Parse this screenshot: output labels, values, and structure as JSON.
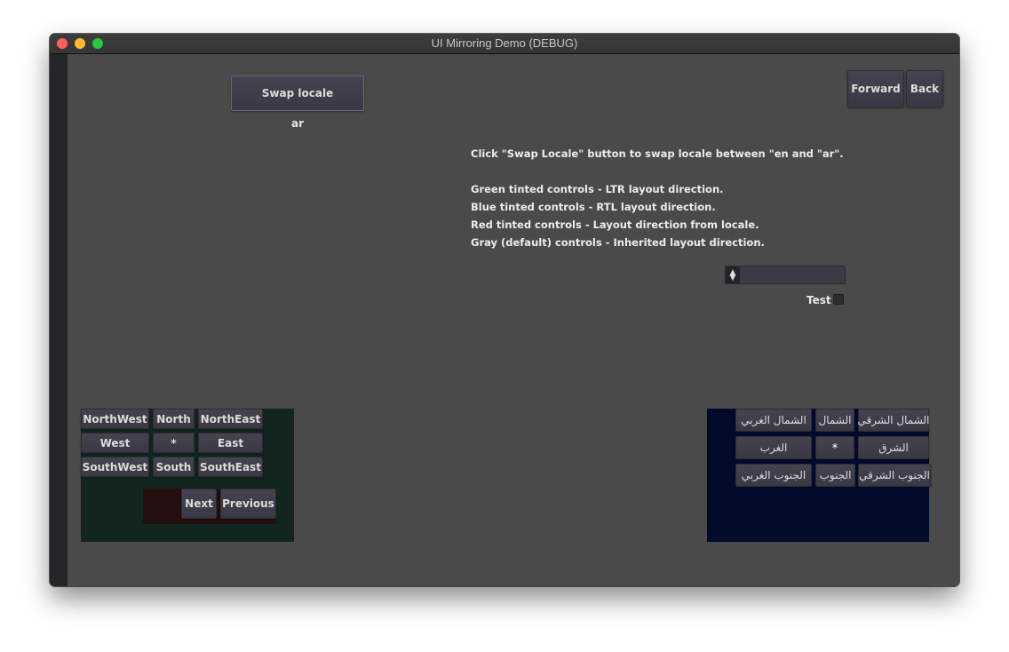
{
  "window": {
    "title": "UI Mirroring Demo (DEBUG)"
  },
  "toolbar": {
    "swap_locale_label": "Swap locale",
    "current_locale": "ar",
    "forward_label": "Forward",
    "back_label": "Back"
  },
  "info": {
    "line1": "Click \"Swap Locale\" button to swap locale between \"en  and \"ar\".",
    "line2": "Green tinted controls - LTR layout direction.",
    "line3": "Blue tinted controls - RTL layout direction.",
    "line4": "Red tinted controls - Layout direction from locale.",
    "line5": "Gray (default) controls - Inherited layout direction."
  },
  "controls": {
    "spinbox_value": "",
    "checkbox_label": "Test",
    "checkbox_checked": false
  },
  "ltr_panel": {
    "tint": "#12261f",
    "buttons": [
      "NorthWest",
      "North",
      "NorthEast",
      "West",
      "*",
      "East",
      "SouthWest",
      "South",
      "SouthEast"
    ],
    "nav": {
      "tint": "#230f10",
      "next_label": "Next",
      "previous_label": "Previous"
    }
  },
  "rtl_panel": {
    "tint": "#020b2c",
    "buttons": [
      "الشمال الغربي",
      "الشمال",
      "الشمال الشرقي",
      "الغرب",
      "*",
      "الشرق",
      "الجنوب الغربي",
      "الجنوب",
      "الجنوب الشرقي"
    ]
  }
}
